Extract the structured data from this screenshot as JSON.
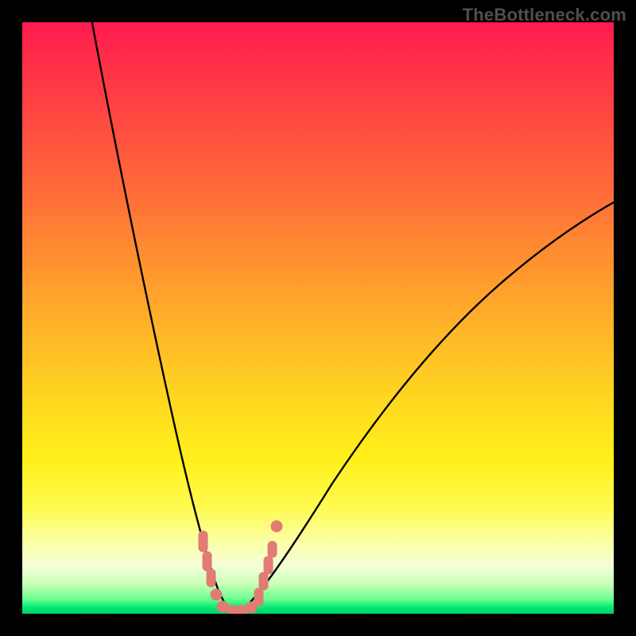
{
  "watermark": "TheBottleneck.com",
  "chart_data": {
    "type": "line",
    "title": "",
    "xlabel": "",
    "ylabel": "",
    "xlim": [
      0,
      100
    ],
    "ylim": [
      0,
      100
    ],
    "series": [
      {
        "name": "bottleneck-curve-left",
        "x": [
          12,
          14,
          16,
          18,
          20,
          22,
          24,
          26,
          28,
          30,
          31.5,
          33,
          34.5
        ],
        "y": [
          100,
          90,
          80,
          70,
          60,
          50,
          40,
          30,
          20,
          12,
          7,
          3,
          0.5
        ]
      },
      {
        "name": "bottleneck-curve-right",
        "x": [
          34.5,
          37,
          40,
          44,
          48,
          54,
          60,
          68,
          76,
          86,
          96,
          100
        ],
        "y": [
          0.5,
          2,
          6,
          12,
          19,
          28,
          36,
          45,
          53,
          61,
          68,
          70
        ]
      },
      {
        "name": "marker-cluster",
        "type": "scatter",
        "x": [
          29.5,
          30.0,
          30.3,
          31.5,
          33.0,
          34.0,
          35.5,
          37.0,
          38.0,
          38.6,
          38.9,
          39.5,
          40.3
        ],
        "y": [
          13.0,
          10.5,
          8.5,
          4.0,
          1.0,
          0.8,
          0.8,
          1.4,
          3.0,
          5.2,
          7.5,
          10.5,
          14.5
        ]
      }
    ],
    "colors": {
      "curve": "#000000",
      "markers": "#e17b74",
      "gradient_top": "#ff1a4f",
      "gradient_mid": "#ffd820",
      "gradient_bottom": "#00d268"
    }
  }
}
